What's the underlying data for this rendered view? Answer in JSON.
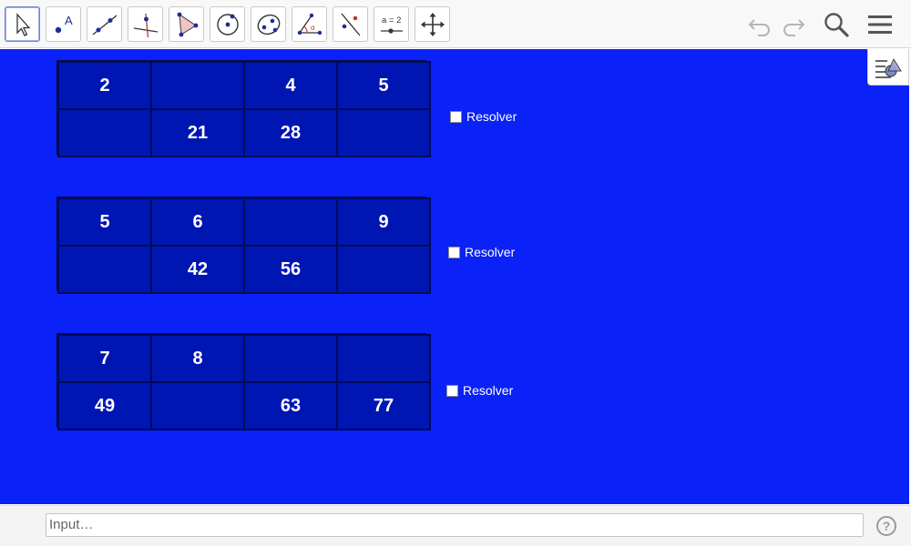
{
  "toolbar": {
    "tools": [
      {
        "name": "move-tool",
        "icon": "cursor-arrow-icon"
      },
      {
        "name": "point-tool",
        "icon": "point-label-icon"
      },
      {
        "name": "line-tool",
        "icon": "line-through-two-points-icon"
      },
      {
        "name": "perpendicular-line-tool",
        "icon": "perpendicular-line-icon"
      },
      {
        "name": "polygon-tool",
        "icon": "polygon-triangle-icon"
      },
      {
        "name": "circle-tool",
        "icon": "circle-center-point-icon"
      },
      {
        "name": "conic-tool",
        "icon": "ellipse-icon"
      },
      {
        "name": "angle-tool",
        "icon": "angle-icon"
      },
      {
        "name": "reflect-tool",
        "icon": "reflect-line-icon"
      },
      {
        "name": "slider-tool",
        "icon": "slider-icon",
        "label": "a = 2"
      },
      {
        "name": "move-graphics-view-tool",
        "icon": "move-arrows-icon"
      }
    ],
    "undo_icon": "undo-icon",
    "redo_icon": "redo-icon",
    "search_icon": "search-icon",
    "menu_icon": "hamburger-menu-icon"
  },
  "graphics": {
    "background": "#0a21f7",
    "tables": [
      {
        "top": [
          "2",
          "",
          "4",
          "5"
        ],
        "bottom": [
          "",
          "21",
          "28",
          ""
        ],
        "checkbox_label": "Resolver"
      },
      {
        "top": [
          "5",
          "6",
          "",
          "9"
        ],
        "bottom": [
          "",
          "42",
          "56",
          ""
        ],
        "checkbox_label": "Resolver"
      },
      {
        "top": [
          "7",
          "8",
          "",
          ""
        ],
        "bottom": [
          "49",
          "",
          "63",
          "77"
        ],
        "checkbox_label": "Resolver"
      }
    ]
  },
  "input_bar": {
    "placeholder": "Input…",
    "help_label": "?"
  }
}
